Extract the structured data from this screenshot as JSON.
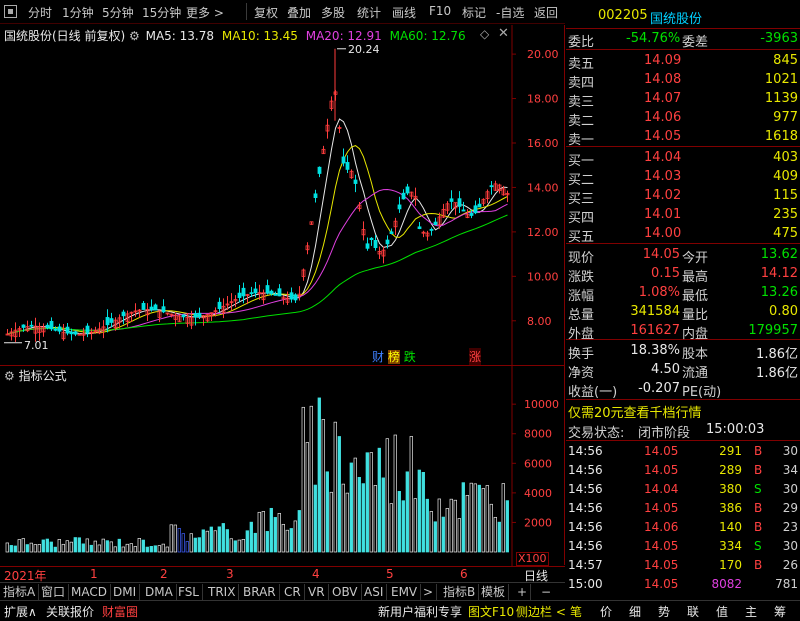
{
  "toolbar": {
    "periods": [
      "分时",
      "1分钟",
      "5分钟",
      "15分钟",
      "更多 >"
    ],
    "tools": [
      "复权",
      "叠加",
      "多股",
      "统计",
      "画线",
      "F10",
      "标记",
      "-自选",
      "返回"
    ]
  },
  "chart": {
    "title": "国统股份(日线 前复权)",
    "ma_legend": [
      {
        "label": "MA5: 13.78",
        "color": "#e8e8e8"
      },
      {
        "label": "MA10: 13.45",
        "color": "#e8e800"
      },
      {
        "label": "MA20: 12.91",
        "color": "#e040e0"
      },
      {
        "label": "MA60: 12.76",
        "color": "#00e000"
      }
    ],
    "price_ticks": [
      "20.00",
      "18.00",
      "16.00",
      "14.00",
      "12.00",
      "10.00",
      "8.00"
    ],
    "high_label": "20.24",
    "low_label": "7.01",
    "markers": [
      {
        "text": "财",
        "color": "#4080ff"
      },
      {
        "text": "榜",
        "color": "#ffff00"
      },
      {
        "text": "跌",
        "color": "#00e000"
      },
      {
        "text": "涨",
        "color": "#ff4040"
      }
    ]
  },
  "indicator": {
    "title": "指标公式",
    "vol_ticks": [
      "10000",
      "8000",
      "6000",
      "4000",
      "2000"
    ],
    "unit": "X100"
  },
  "date_axis": {
    "year": "2021年",
    "months": [
      "1",
      "2",
      "3",
      "4",
      "5",
      "6"
    ],
    "period": "日线"
  },
  "indicator_tabs": [
    "指标A",
    "窗口",
    "MACD",
    "DMI",
    "DMA",
    "FSL",
    "TRIX",
    "BRAR",
    "CR",
    "VR",
    "OBV",
    "ASI",
    "EMV",
    ">",
    "指标B",
    "模板",
    "+",
    "−"
  ],
  "status_bar": {
    "left": [
      "扩展∧",
      "关联报价",
      "财富圈"
    ],
    "center": [
      "新用户福利专享",
      "图文F10",
      "侧边栏 <"
    ],
    "right_tabs": [
      "笔",
      "价",
      "细",
      "势",
      "联",
      "值",
      "主",
      "筹"
    ]
  },
  "stock": {
    "code": "002205",
    "name": "国统股份",
    "weibi_label": "委比",
    "weibi": "-54.76%",
    "weicha_label": "委差",
    "weicha": "-3963"
  },
  "asks": [
    {
      "label": "卖五",
      "price": "14.09",
      "vol": "845"
    },
    {
      "label": "卖四",
      "price": "14.08",
      "vol": "1021"
    },
    {
      "label": "卖三",
      "price": "14.07",
      "vol": "1139"
    },
    {
      "label": "卖二",
      "price": "14.06",
      "vol": "977"
    },
    {
      "label": "卖一",
      "price": "14.05",
      "vol": "1618"
    }
  ],
  "bids": [
    {
      "label": "买一",
      "price": "14.04",
      "vol": "403"
    },
    {
      "label": "买二",
      "price": "14.03",
      "vol": "409"
    },
    {
      "label": "买三",
      "price": "14.02",
      "vol": "115"
    },
    {
      "label": "买四",
      "price": "14.01",
      "vol": "235"
    },
    {
      "label": "买五",
      "price": "14.00",
      "vol": "475"
    }
  ],
  "quote": [
    {
      "l1": "现价",
      "v1": "14.05",
      "c1": "red",
      "l2": "今开",
      "v2": "13.62",
      "c2": "green"
    },
    {
      "l1": "涨跌",
      "v1": "0.15",
      "c1": "red",
      "l2": "最高",
      "v2": "14.12",
      "c2": "red"
    },
    {
      "l1": "涨幅",
      "v1": "1.08%",
      "c1": "red",
      "l2": "最低",
      "v2": "13.26",
      "c2": "green"
    },
    {
      "l1": "总量",
      "v1": "341584",
      "c1": "yellow",
      "l2": "量比",
      "v2": "0.80",
      "c2": "yellow"
    },
    {
      "l1": "外盘",
      "v1": "161627",
      "c1": "red",
      "l2": "内盘",
      "v2": "179957",
      "c2": "green"
    }
  ],
  "fundamentals": [
    {
      "l1": "换手",
      "v1": "18.38%",
      "l2": "股本",
      "v2": "1.86亿"
    },
    {
      "l1": "净资",
      "v1": "4.50",
      "l2": "流通",
      "v2": "1.86亿"
    },
    {
      "l1": "收益(一)",
      "v1": "-0.207",
      "l2": "PE(动)",
      "v2": ""
    }
  ],
  "promo": "仅需20元查看千档行情",
  "trade_status": {
    "label": "交易状态:",
    "value": "闭市阶段",
    "time": "15:00:03"
  },
  "trades": [
    {
      "time": "14:56",
      "price": "14.05",
      "vol": "291",
      "side": "B",
      "count": "30"
    },
    {
      "time": "14:56",
      "price": "14.05",
      "vol": "289",
      "side": "B",
      "count": "34"
    },
    {
      "time": "14:56",
      "price": "14.04",
      "vol": "380",
      "side": "S",
      "count": "30"
    },
    {
      "time": "14:56",
      "price": "14.05",
      "vol": "386",
      "side": "B",
      "count": "29"
    },
    {
      "time": "14:56",
      "price": "14.06",
      "vol": "140",
      "side": "B",
      "count": "23"
    },
    {
      "time": "14:56",
      "price": "14.05",
      "vol": "334",
      "side": "S",
      "count": "30"
    },
    {
      "time": "14:57",
      "price": "14.05",
      "vol": "170",
      "side": "B",
      "count": "26"
    },
    {
      "time": "15:00",
      "price": "14.05",
      "vol": "8082",
      "side": "",
      "count": "781"
    }
  ]
}
